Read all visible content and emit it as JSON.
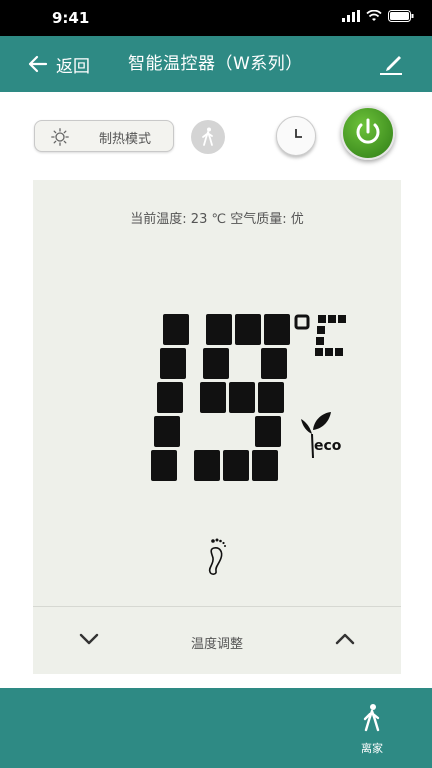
{
  "status_bar": {
    "time": "9:41"
  },
  "header": {
    "back_label": "返回",
    "title": "智能温控器（W系列）"
  },
  "controls": {
    "mode_label": "制热模式"
  },
  "display": {
    "status_line": "当前温度: 23 ℃   空气质量: 优",
    "set_temperature": "19",
    "unit": "℃",
    "eco_label": "eco"
  },
  "adjust": {
    "label": "温度调整"
  },
  "footer": {
    "away_label": "离家"
  },
  "colors": {
    "primary": "#2e8a84",
    "power": "#4fa82a",
    "panel": "#eef0ea"
  },
  "icons": [
    "back-arrow-icon",
    "edit-icon",
    "sun-icon",
    "walk-icon",
    "clock-icon",
    "power-icon",
    "leaf-icon",
    "foot-icon",
    "chevron-down-icon",
    "chevron-up-icon",
    "person-walk-icon"
  ]
}
